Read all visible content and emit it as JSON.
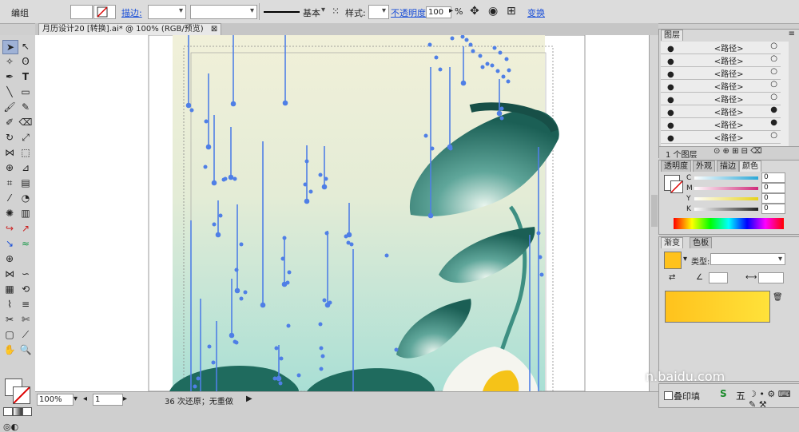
{
  "control_bar": {
    "mode_label": "编组",
    "stroke_label": "描边:",
    "line_label": "基本",
    "style_label": "样式:",
    "opacity_label": "不透明度:",
    "opacity_value": "100",
    "opacity_unit": "%",
    "transform_label": "变换"
  },
  "document": {
    "tab_title": "月历设计20 [转换].ai* @ 100% (RGB/预览)",
    "tab_close": "⊠"
  },
  "status_bar": {
    "zoom": "100%",
    "page": "1",
    "undo_text": "36 次还原；无重做"
  },
  "layers_panel": {
    "title": "图层",
    "rows": [
      "<路径>",
      "<路径>",
      "<路径>",
      "<路径>",
      "<路径>",
      "<路径>",
      "<路径>",
      "<路径>"
    ],
    "footer": "1 个图层"
  },
  "color_panel": {
    "tabs": [
      "透明度",
      "外观",
      "描边",
      "颜色"
    ],
    "channels": [
      {
        "label": "C",
        "value": "0",
        "color": "#2aa8d8"
      },
      {
        "label": "M",
        "value": "0",
        "color": "#d02a7a"
      },
      {
        "label": "Y",
        "value": "0",
        "color": "#e6d21a"
      },
      {
        "label": "K",
        "value": "0",
        "color": "#222222"
      }
    ]
  },
  "gradient_panel": {
    "tabs": [
      "渐变",
      "色板"
    ],
    "type_label": "类型:"
  },
  "bottom_panel": {
    "label": "叠印填"
  },
  "watermark": "n.baidu.com",
  "ime_bar": "五",
  "colors": {
    "selection_blue": "#4f7fe6",
    "leaf_dark": "#1e6b5e",
    "bg_top": "#f1f0d9",
    "bg_bottom": "#a9dfd5",
    "gradient_start": "#ffc21c",
    "gradient_end": "#ffe23a"
  }
}
